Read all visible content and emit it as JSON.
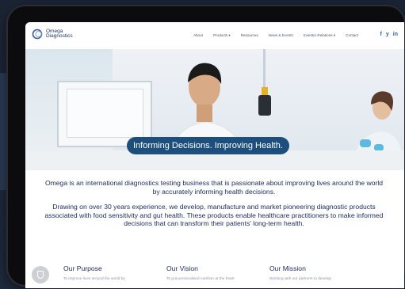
{
  "nav": {
    "logo_line1": "Omega",
    "logo_line2": "Diagnostics",
    "items": [
      "About",
      "Products ▾",
      "Resources",
      "News & Events",
      "Investor Relations ▾",
      "Contact"
    ],
    "social": [
      "f",
      "y",
      "in"
    ]
  },
  "hero": {
    "tagline": "Informing Decisions. Improving Health."
  },
  "intro": {
    "p1": "Omega is an international diagnostics testing business that is passionate about improving lives around the world by accurately informing health decisions.",
    "p2": "Drawing on over 30 years experience, we develop, manufacture and market pioneering diagnostic products associated with food sensitivity and gut health.  These products enable healthcare practitioners to make informed decisions that can transform their patients' long-term health."
  },
  "sections": [
    {
      "title": "Our Purpose",
      "sub": "To improve lives around the world by"
    },
    {
      "title": "Our Vision",
      "sub": "To put personalised nutrition at the heart"
    },
    {
      "title": "Our Mission",
      "sub": "Working with our partners to develop"
    }
  ],
  "colors": {
    "brand": "#1c4f7d",
    "text": "#1b2b5a",
    "social": "#2f5fb3"
  }
}
